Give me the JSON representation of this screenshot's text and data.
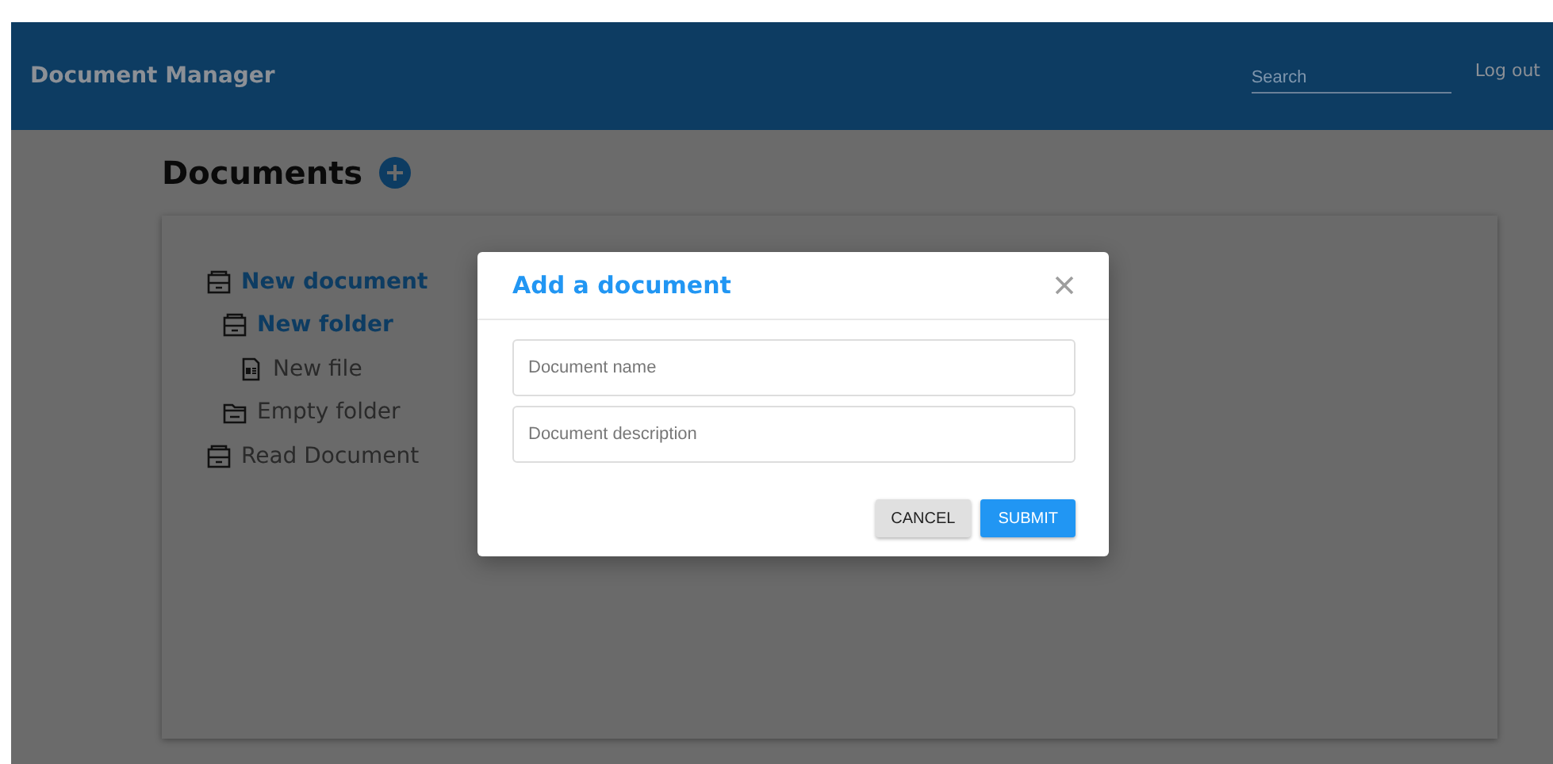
{
  "header": {
    "title": "Document Manager",
    "search": {
      "placeholder": "Search"
    },
    "logout": "Log out"
  },
  "page": {
    "title": "Documents"
  },
  "tree": [
    {
      "label": "New document",
      "kind": "document",
      "highlighted": true,
      "children": [
        {
          "label": "New folder",
          "kind": "document",
          "highlighted": true,
          "children": [
            {
              "label": "New file",
              "kind": "file",
              "highlighted": false
            }
          ]
        },
        {
          "label": "Empty folder",
          "kind": "folder",
          "highlighted": false
        }
      ]
    },
    {
      "label": "Read Document",
      "kind": "document",
      "highlighted": false
    }
  ],
  "dialog": {
    "title": "Add a document",
    "fields": [
      {
        "placeholder": "Document name"
      },
      {
        "placeholder": "Document description"
      }
    ],
    "buttons": [
      {
        "label": "CANCEL",
        "kind": "secondary"
      },
      {
        "label": "SUBMIT",
        "kind": "primary"
      }
    ]
  }
}
